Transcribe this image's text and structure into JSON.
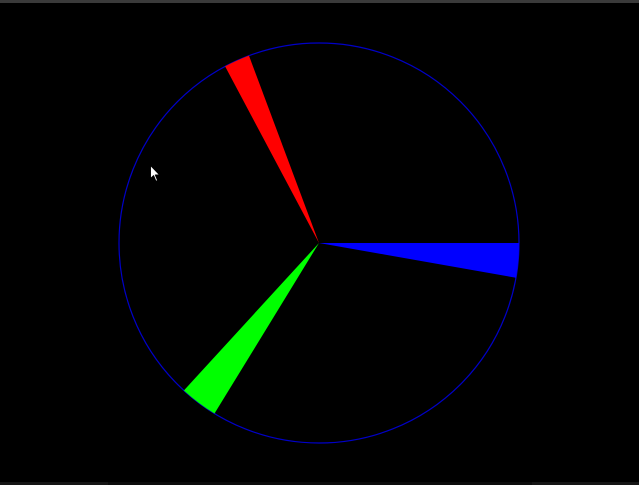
{
  "colors": {
    "background": "#000000",
    "window_border": "#3a3a3a",
    "outline": "#0000c8",
    "sector_red": "#ff0000",
    "sector_green": "#00ff00",
    "sector_blue": "#0000ff"
  },
  "scene": {
    "sectors": [
      {
        "id": "red",
        "color_key": "sector_red",
        "start_deg": 110.5,
        "end_deg": 118.0
      },
      {
        "id": "green",
        "color_key": "sector_green",
        "start_deg": 227.5,
        "end_deg": 238.5
      },
      {
        "id": "blue",
        "color_key": "sector_blue",
        "start_deg": 350.0,
        "end_deg": 360.0
      }
    ]
  },
  "cursor": {
    "icon": "arrow-pointer-icon"
  }
}
